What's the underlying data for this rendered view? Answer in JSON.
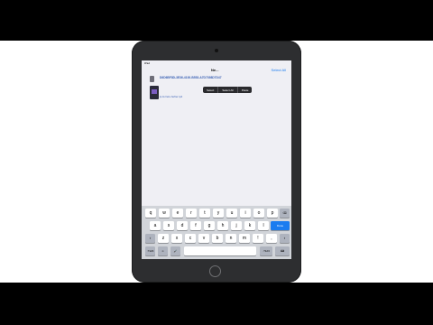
{
  "status_bar": {
    "carrier": "iPad",
    "time": "",
    "battery": ""
  },
  "nav": {
    "back": "",
    "title": "Ne...",
    "right": "Select All"
  },
  "file": {
    "name": "D6D6BF8D-3E36-4100-B553-A7D7398D7D47"
  },
  "selected_item": {
    "label": "ip-ferrets-hefter.ip4"
  },
  "edit_menu": {
    "items": [
      "Select",
      "Select All",
      "Paste"
    ]
  },
  "keyboard": {
    "row1": [
      "q",
      "w",
      "e",
      "r",
      "t",
      "y",
      "u",
      "i",
      "o",
      "p"
    ],
    "backspace": "⌫",
    "row2": [
      "a",
      "s",
      "d",
      "f",
      "g",
      "h",
      "j",
      "k",
      "l"
    ],
    "done_label": "Done",
    "row3": [
      "z",
      "x",
      "c",
      "v",
      "b",
      "n",
      "m",
      "!",
      ","
    ],
    "shift": "⇧",
    "numbers_label": ".?123",
    "emoji": "☺",
    "mic": "🎤",
    "space_label": "",
    "hide_keyboard": "⌨"
  },
  "colors": {
    "accent": "#1a7cf0",
    "screen_bg": "#efeff4",
    "device_frame": "#2d2e30",
    "keyboard_bg": "#d1d4d9"
  }
}
